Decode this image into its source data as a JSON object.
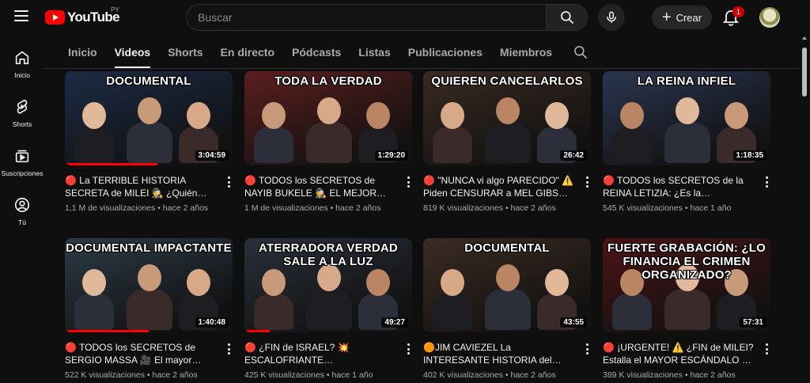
{
  "header": {
    "logo_text": "YouTube",
    "country_code": "PY",
    "search_placeholder": "Buscar",
    "create_label": "Crear",
    "notification_count": "1"
  },
  "sidebar": {
    "items": [
      {
        "label": "Inicio",
        "icon": "home-icon"
      },
      {
        "label": "Shorts",
        "icon": "shorts-icon"
      },
      {
        "label": "Suscripciones",
        "icon": "subscriptions-icon"
      },
      {
        "label": "Tú",
        "icon": "user-icon"
      }
    ]
  },
  "tabs": [
    {
      "label": "Inicio",
      "active": false
    },
    {
      "label": "Videos",
      "active": true
    },
    {
      "label": "Shorts",
      "active": false
    },
    {
      "label": "En directo",
      "active": false
    },
    {
      "label": "Pódcasts",
      "active": false
    },
    {
      "label": "Listas",
      "active": false
    },
    {
      "label": "Publicaciones",
      "active": false
    },
    {
      "label": "Miembros",
      "active": false
    }
  ],
  "videos": [
    {
      "thumb_text": "DOCUMENTAL",
      "thumb_color": "#1c2b45",
      "duration": "3:04:59",
      "progress": 0.55,
      "title": "🔴 La TERRIBLE HISTORIA SECRETA de MILEI 🕵 ¿Quién es…",
      "meta": "1,1 M de visualizaciones • hace 2 años"
    },
    {
      "thumb_text": "TODA LA VERDAD",
      "thumb_color": "#5b1e1e",
      "duration": "1:29:20",
      "progress": 0.0,
      "title": "🔴 TODOS los SECRETOS de NAYIB BUKELE 🕵 EL MEJOR…",
      "meta": "1 M de visualizaciones • hace 2 años"
    },
    {
      "thumb_text": "QUIEREN CANCELARLOS",
      "thumb_color": "#3a2a22",
      "duration": "26:42",
      "progress": 0.0,
      "title": "🔴 \"NUNCA vi algo PARECIDO\" ⚠️ Piden CENSURAR a MEL GIBSON y…",
      "meta": "819 K visualizaciones • hace 2 años"
    },
    {
      "thumb_text": "LA REINA INFIEL",
      "thumb_color": "#2a3550",
      "duration": "1:18:35",
      "progress": 0.0,
      "title": "🔴 TODOS los SECRETOS de la REINA LETIZIA: ¿Es la PRINCESA…",
      "meta": "545 K visualizaciones • hace 1 año"
    },
    {
      "thumb_text": "DOCUMENTAL IMPACTANTE",
      "thumb_color": "#2c3b46",
      "duration": "1:40:48",
      "progress": 0.5,
      "title": "🔴 TODOS los SECRETOS de SERGIO MASSA 🎥 El mayor…",
      "meta": "522 K visualizaciones • hace 2 años"
    },
    {
      "thumb_text": "ATERRADORA VERDAD SALE A LA LUZ",
      "thumb_color": "#2a2f3a",
      "duration": "49:27",
      "progress": 0.15,
      "title": "🔴 ¿FIN de ISRAEL? 💥 ESCALOFRIANTE REVELACIÓN…",
      "meta": "425 K visualizaciones • hace 1 año"
    },
    {
      "thumb_text": "DOCUMENTAL",
      "thumb_color": "#3b2c22",
      "duration": "43:55",
      "progress": 0.0,
      "title": "🟠JIM CAVIEZEL La INTERESANTE HISTORIA del actor de Sound of…",
      "meta": "402 K visualizaciones • hace 2 años"
    },
    {
      "thumb_text": "FUERTE GRABACIÓN: ¿LO FINANCIA EL CRIMEN ORGANIZADO?",
      "thumb_color": "#4a1414",
      "duration": "57:31",
      "progress": 0.0,
      "title": "🔴 ¡URGENTE! ⚠️ ¿FIN de MILEI? Estalla el MAYOR ESCÁNDALO de l…",
      "meta": "389 K visualizaciones • hace 2 años"
    }
  ]
}
